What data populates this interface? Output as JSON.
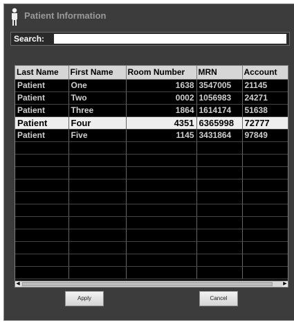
{
  "window": {
    "title": "Patient Information"
  },
  "search": {
    "label": "Search:",
    "value": ""
  },
  "grid": {
    "columns": [
      "Last Name",
      "First Name",
      "Room Number",
      "MRN",
      "Account"
    ],
    "rows": [
      [
        "Patient",
        "One",
        "1638",
        "3547005",
        "21145"
      ],
      [
        "Patient",
        "Two",
        "0002",
        "1056983",
        "24271"
      ],
      [
        "Patient",
        "Three",
        "1864",
        "1614174",
        "51638"
      ],
      [
        "Patient",
        "Four",
        "4351",
        "6365998",
        "72777"
      ],
      [
        "Patient",
        "Five",
        "1145",
        "3431864",
        "97849"
      ]
    ],
    "selected_row": 3
  },
  "buttons": {
    "apply": "Apply",
    "cancel": "Cancel"
  },
  "icons": {
    "title": "person-icon",
    "scroll_left": "arrow-left-icon",
    "scroll_right": "arrow-right-icon"
  }
}
